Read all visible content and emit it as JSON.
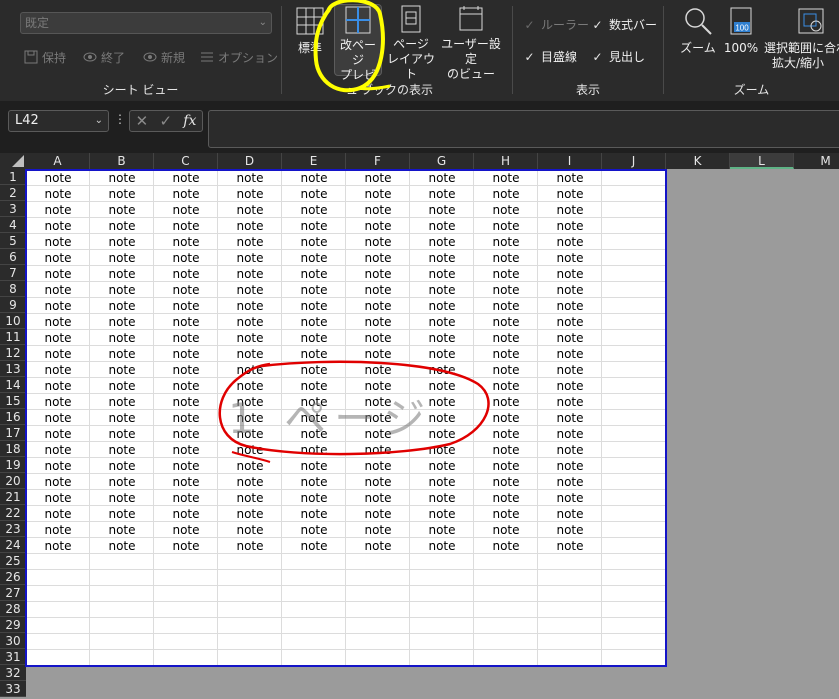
{
  "ribbon": {
    "sheet_view": {
      "select_value": "既定",
      "keep_label": "保持",
      "exit_label": "終了",
      "new_label": "新規",
      "options_label": "オプション",
      "group_label": "シート ビュー"
    },
    "workbook_views": {
      "normal_label": "標準",
      "page_break_label_1": "改ページ",
      "page_break_label_2": "プレビュー",
      "page_layout_label_1": "ページ",
      "page_layout_label_2": "レイアウト",
      "custom_view_label_1": "ユーザー設定",
      "custom_view_label_2": "のビュー",
      "group_label": "ブックの表示"
    },
    "show": {
      "ruler_label": "ルーラー",
      "formula_bar_label": "数式バー",
      "gridlines_label": "目盛線",
      "headings_label": "見出し",
      "group_label": "表示"
    },
    "zoom": {
      "zoom_label": "ズーム",
      "zoom100_label": "100%",
      "zoom100_icon_text": "100",
      "fit_selection_label_1": "選択範囲に合わ",
      "fit_selection_label_2": "拡大/縮小",
      "group_label": "ズーム"
    }
  },
  "formula_bar": {
    "name_box": "L42",
    "fx_label": "fx"
  },
  "grid": {
    "columns": [
      "A",
      "B",
      "C",
      "D",
      "E",
      "F",
      "G",
      "H",
      "I",
      "J",
      "K",
      "L",
      "M"
    ],
    "selected_column": "L",
    "rows": [
      "1",
      "2",
      "3",
      "4",
      "5",
      "6",
      "7",
      "8",
      "9",
      "10",
      "11",
      "12",
      "13",
      "14",
      "15",
      "16",
      "17",
      "18",
      "19",
      "20",
      "21",
      "22",
      "23",
      "24",
      "25",
      "26",
      "27",
      "28",
      "29",
      "30",
      "31",
      "32",
      "33"
    ],
    "cell_text": "note",
    "filled_rows": 24,
    "filled_cols": 9,
    "page_watermark": "1 ページ"
  },
  "colors": {
    "page_border": "#1414c8",
    "annotation_yellow": "#ffff00",
    "annotation_red": "#e00000",
    "selected_header_underline": "#5fb386"
  }
}
